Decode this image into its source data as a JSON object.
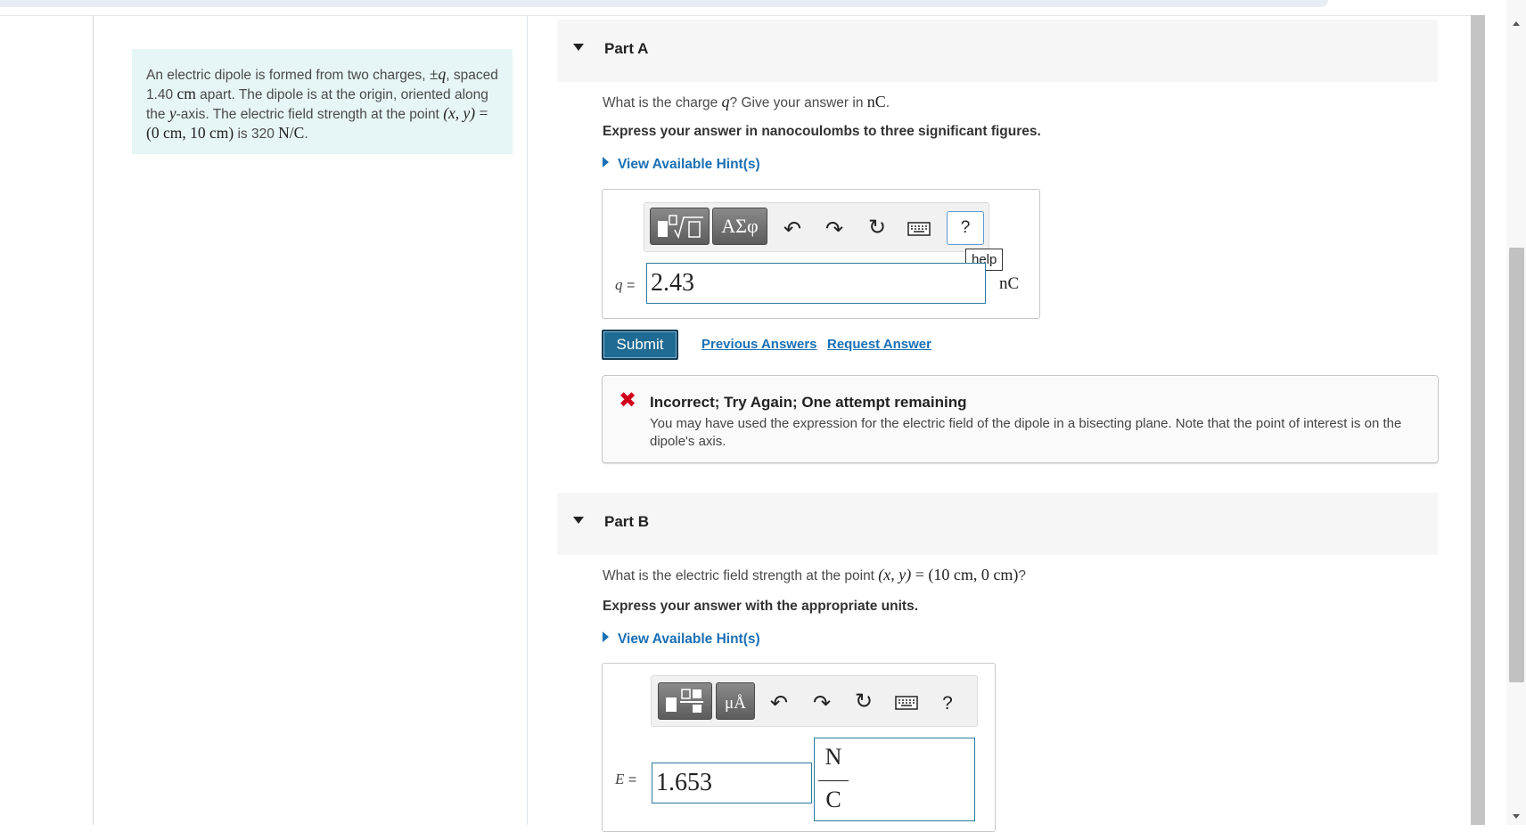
{
  "problem": {
    "s1": "An electric dipole is formed from two charges, ",
    "m1": "±q",
    "s2": ", spaced 1.40 ",
    "m2": "cm",
    "s3": " apart. The dipole is at the origin, oriented along the ",
    "m3": "y",
    "s4": "-axis. The electric field strength at the point ",
    "m4": "(x, y)",
    "m5": " = ",
    "m6": "(0 cm,  10 cm)",
    "s5": " is 320 ",
    "m7": "N/C",
    "s6": "."
  },
  "partA": {
    "title": "Part A",
    "q1": "What is the charge ",
    "qm1": "q",
    "q2": "? Give your answer in ",
    "qm2": "nC",
    "q3": ".",
    "instruction": "Express your answer in nanocoulombs to three significant figures.",
    "hint": "View Available Hint(s)",
    "toolbar": {
      "templates_label": "√□",
      "symbols_label": "ΑΣφ",
      "help_label": "?",
      "tooltip": "help"
    },
    "var_label": "q",
    "eq": " = ",
    "answer": "2.43",
    "unit": "nC",
    "submit": "Submit",
    "previous": "Previous Answers",
    "request": "Request Answer",
    "feedback": {
      "title": "Incorrect; Try Again; One attempt remaining",
      "message": "You may have used the expression for the electric field of the dipole in a bisecting plane. Note that the point of interest is on the dipole's axis."
    }
  },
  "partB": {
    "title": "Part B",
    "q1": "What is the electric field strength at the point ",
    "qm1": "(x, y)",
    "qm2": " = ",
    "qm3": "(10 cm,  0 cm)",
    "q2": "?",
    "instruction": "Express your answer with the appropriate units.",
    "hint": "View Available Hint(s)",
    "toolbar": {
      "units_label": "μÅ",
      "help_label": "?"
    },
    "var_label": "E",
    "eq": " = ",
    "answer": "1.653",
    "unit_num": "N",
    "unit_den": "C"
  },
  "colors": {
    "accent": "#1a6fb4",
    "submit": "#1f6b93",
    "error": "#d0021b",
    "problem_bg": "#e6f5f6"
  }
}
